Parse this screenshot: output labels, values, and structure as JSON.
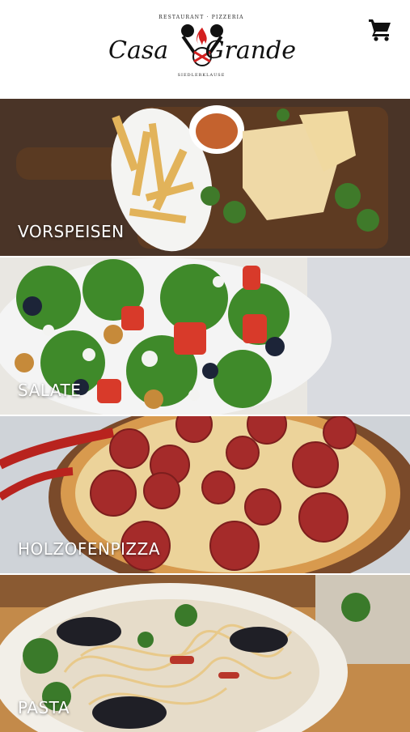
{
  "header": {
    "logo": {
      "top_text": "RESTAURANT · PIZZERIA",
      "name_left": "Casa",
      "name_right": "Grande",
      "bottom_text": "SIEDLERKLAUSE"
    },
    "cart_icon": "shopping-cart-icon"
  },
  "categories": [
    {
      "label": "VORSPEISEN"
    },
    {
      "label": "SALATE"
    },
    {
      "label": "HOLZOFENPIZZA"
    },
    {
      "label": "PASTA"
    }
  ]
}
